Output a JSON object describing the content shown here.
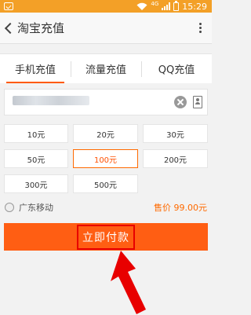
{
  "status_bar": {
    "network": "4G",
    "time": "15:29",
    "bg_color": "#f3a027"
  },
  "header": {
    "title": "淘宝充值",
    "back_icon": "chevron-left-icon",
    "more_icon": "more-vertical-icon"
  },
  "tabs": [
    {
      "label": "手机充值",
      "active": true
    },
    {
      "label": "流量充值",
      "active": false
    },
    {
      "label": "QQ充值",
      "active": false
    }
  ],
  "phone": {
    "value": "",
    "clear_icon": "clear-icon",
    "contacts_icon": "contacts-icon"
  },
  "denominations": [
    {
      "label": "10元",
      "selected": false
    },
    {
      "label": "20元",
      "selected": false
    },
    {
      "label": "30元",
      "selected": false
    },
    {
      "label": "50元",
      "selected": false
    },
    {
      "label": "100元",
      "selected": true
    },
    {
      "label": "200元",
      "selected": false
    },
    {
      "label": "300元",
      "selected": false
    },
    {
      "label": "500元",
      "selected": false
    }
  ],
  "carrier": {
    "name": "广东移动",
    "price": "售价 99.00元"
  },
  "pay_button": {
    "label": "立即付款",
    "color": "#ff5e13"
  },
  "accent_color": "#ff5a00",
  "annotation_color": "#e80000"
}
